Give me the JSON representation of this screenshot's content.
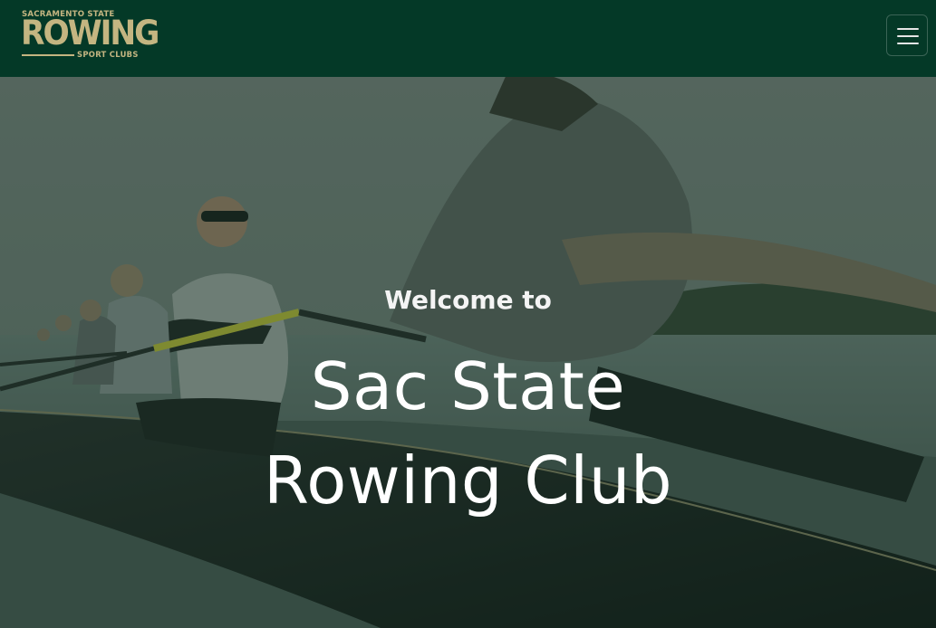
{
  "navbar": {
    "logo": {
      "top_text": "SACRAMENTO STATE",
      "main_text": "ROWING",
      "bottom_text": "SPORT CLUBS"
    },
    "toggle_icon": "hamburger-menu-icon"
  },
  "hero": {
    "welcome": "Welcome to",
    "title_line1": "Sac State",
    "title_line2": "Rowing Club"
  },
  "colors": {
    "nav_bg": "#043927",
    "logo_gold": "#c4b581",
    "hero_text": "#ffffff"
  }
}
